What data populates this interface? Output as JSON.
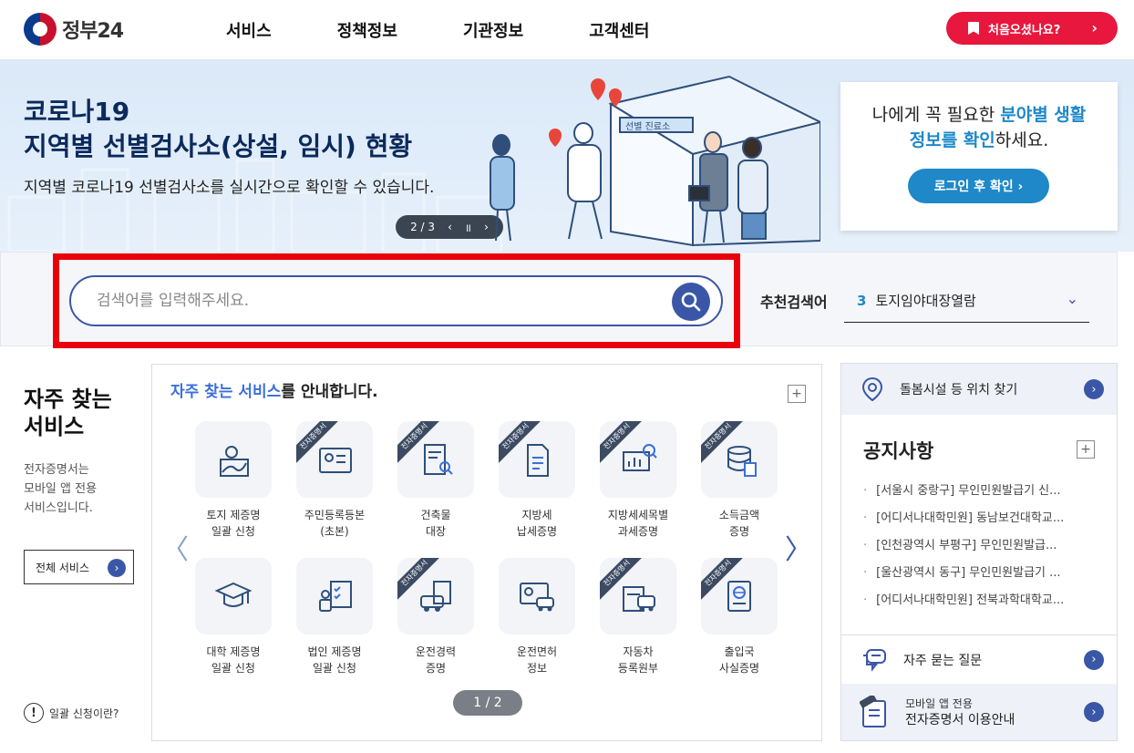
{
  "header": {
    "logo_text": "정부24",
    "nav": [
      "서비스",
      "정책정보",
      "기관정보",
      "고객센터"
    ],
    "first_visit": "처음오셨나요?",
    "first_visit_chevron": "›"
  },
  "banner": {
    "title_line1": "코로나19",
    "title_line2": "지역별 선별검사소(상설, 임시) 현황",
    "desc": "지역별 코로나19 선별검사소를 실시간으로 확인할 수 있습니다.",
    "slide_counter": "2 / 3",
    "prev": "‹",
    "pause": "॥",
    "next": "›",
    "tent_sign": "선별 진료소"
  },
  "login_card": {
    "text_a": "나에게 꼭 필요한 ",
    "text_hl1": "분야별 생활",
    "text_hl2": "정보를 확인",
    "text_b": "하세요.",
    "button": "로그인 후 확인 ›"
  },
  "search": {
    "placeholder": "검색어를 입력해주세요.",
    "rec_label": "추천검색어",
    "rec_number": "3",
    "rec_term": "토지임야대장열람",
    "rec_chevron": "⌄"
  },
  "frequent": {
    "title_line1": "자주 찾는",
    "title_line2": "서비스",
    "desc_line1": "전자증명서는",
    "desc_line2": "모바일 앱 전용",
    "desc_line3": "서비스입니다.",
    "all_button": "전체 서비스",
    "bulk_info": "일괄 신청이란?"
  },
  "services": {
    "heading_hl": "자주 찾는 서비스",
    "heading_rest": "를 안내합니다.",
    "ribbon": "전자증명서",
    "pager": "1 / 2",
    "items": [
      {
        "l1": "토지 제증명",
        "l2": "일괄 신청",
        "icon": "map-icon",
        "ribbon": false
      },
      {
        "l1": "주민등록등본",
        "l2": "(초본)",
        "icon": "id-card-icon",
        "ribbon": true
      },
      {
        "l1": "건축물",
        "l2": "대장",
        "icon": "document-search-icon",
        "ribbon": true
      },
      {
        "l1": "지방세",
        "l2": "납세증명",
        "icon": "document-icon",
        "ribbon": true
      },
      {
        "l1": "지방세세목별",
        "l2": "과세증명",
        "icon": "chart-search-icon",
        "ribbon": true
      },
      {
        "l1": "소득금액",
        "l2": "증명",
        "icon": "database-icon",
        "ribbon": true
      },
      {
        "l1": "대학 제증명",
        "l2": "일괄 신청",
        "icon": "graduation-cap-icon",
        "ribbon": false
      },
      {
        "l1": "법인 제증명",
        "l2": "일괄 신청",
        "icon": "stamp-checklist-icon",
        "ribbon": false
      },
      {
        "l1": "운전경력",
        "l2": "증명",
        "icon": "car-document-icon",
        "ribbon": true
      },
      {
        "l1": "운전면허",
        "l2": "정보",
        "icon": "license-car-icon",
        "ribbon": false
      },
      {
        "l1": "자동차",
        "l2": "등록원부",
        "icon": "car-register-icon",
        "ribbon": true
      },
      {
        "l1": "출입국",
        "l2": "사실증명",
        "icon": "passport-icon",
        "ribbon": true
      }
    ]
  },
  "right": {
    "care_facility": "돌봄시설 등 위치 찾기",
    "notice_title": "공지사항",
    "notices": [
      "[서울시 중랑구] 무인민원발급기 신...",
      "[어디서나대학민원] 동남보건대학교...",
      "[인천광역시 부평구] 무인민원발급...",
      "[울산광역시 동구] 무인민원발급기 ...",
      "[어디서나대학민원] 전북과학대학교..."
    ],
    "faq": "자주 묻는 질문",
    "mobile_line1": "모바일 앱 전용",
    "mobile_line2": "전자증명서 이용안내"
  },
  "colors": {
    "primary": "#3a57a7",
    "accent_red": "#e8173d",
    "highlight_blue": "#1e88c9"
  }
}
